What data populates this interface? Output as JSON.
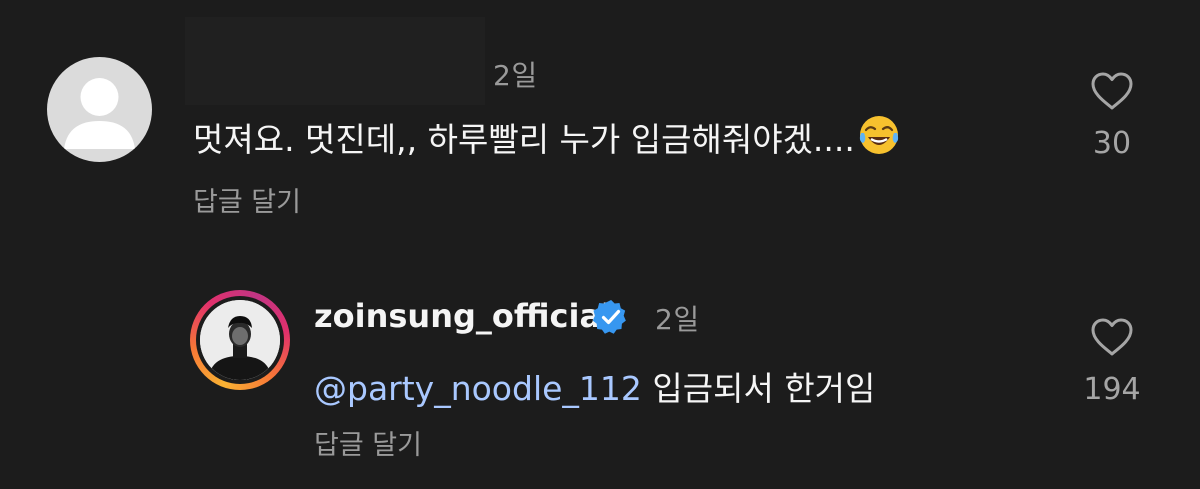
{
  "comments": [
    {
      "time": "2일",
      "text": "멋져요. 멋진데,, 하루빨리 누가 입금해줘야겠....",
      "emoji": "face-with-tears-of-joy",
      "reply_label": "답글 달기",
      "likes": "30"
    },
    {
      "username": "zoinsung_official",
      "verified": true,
      "time": "2일",
      "mention": "@party_noodle_112",
      "text": " 입금되서 한거임",
      "reply_label": "답글 달기",
      "likes": "194"
    }
  ],
  "colors": {
    "background": "#1c1c1c",
    "secondary_text": "#9a9a9a",
    "mention": "#a9c8ff",
    "verified_badge": "#3797f0"
  },
  "icons": [
    "default-avatar-icon",
    "heart-outline-icon",
    "verified-badge-icon"
  ]
}
